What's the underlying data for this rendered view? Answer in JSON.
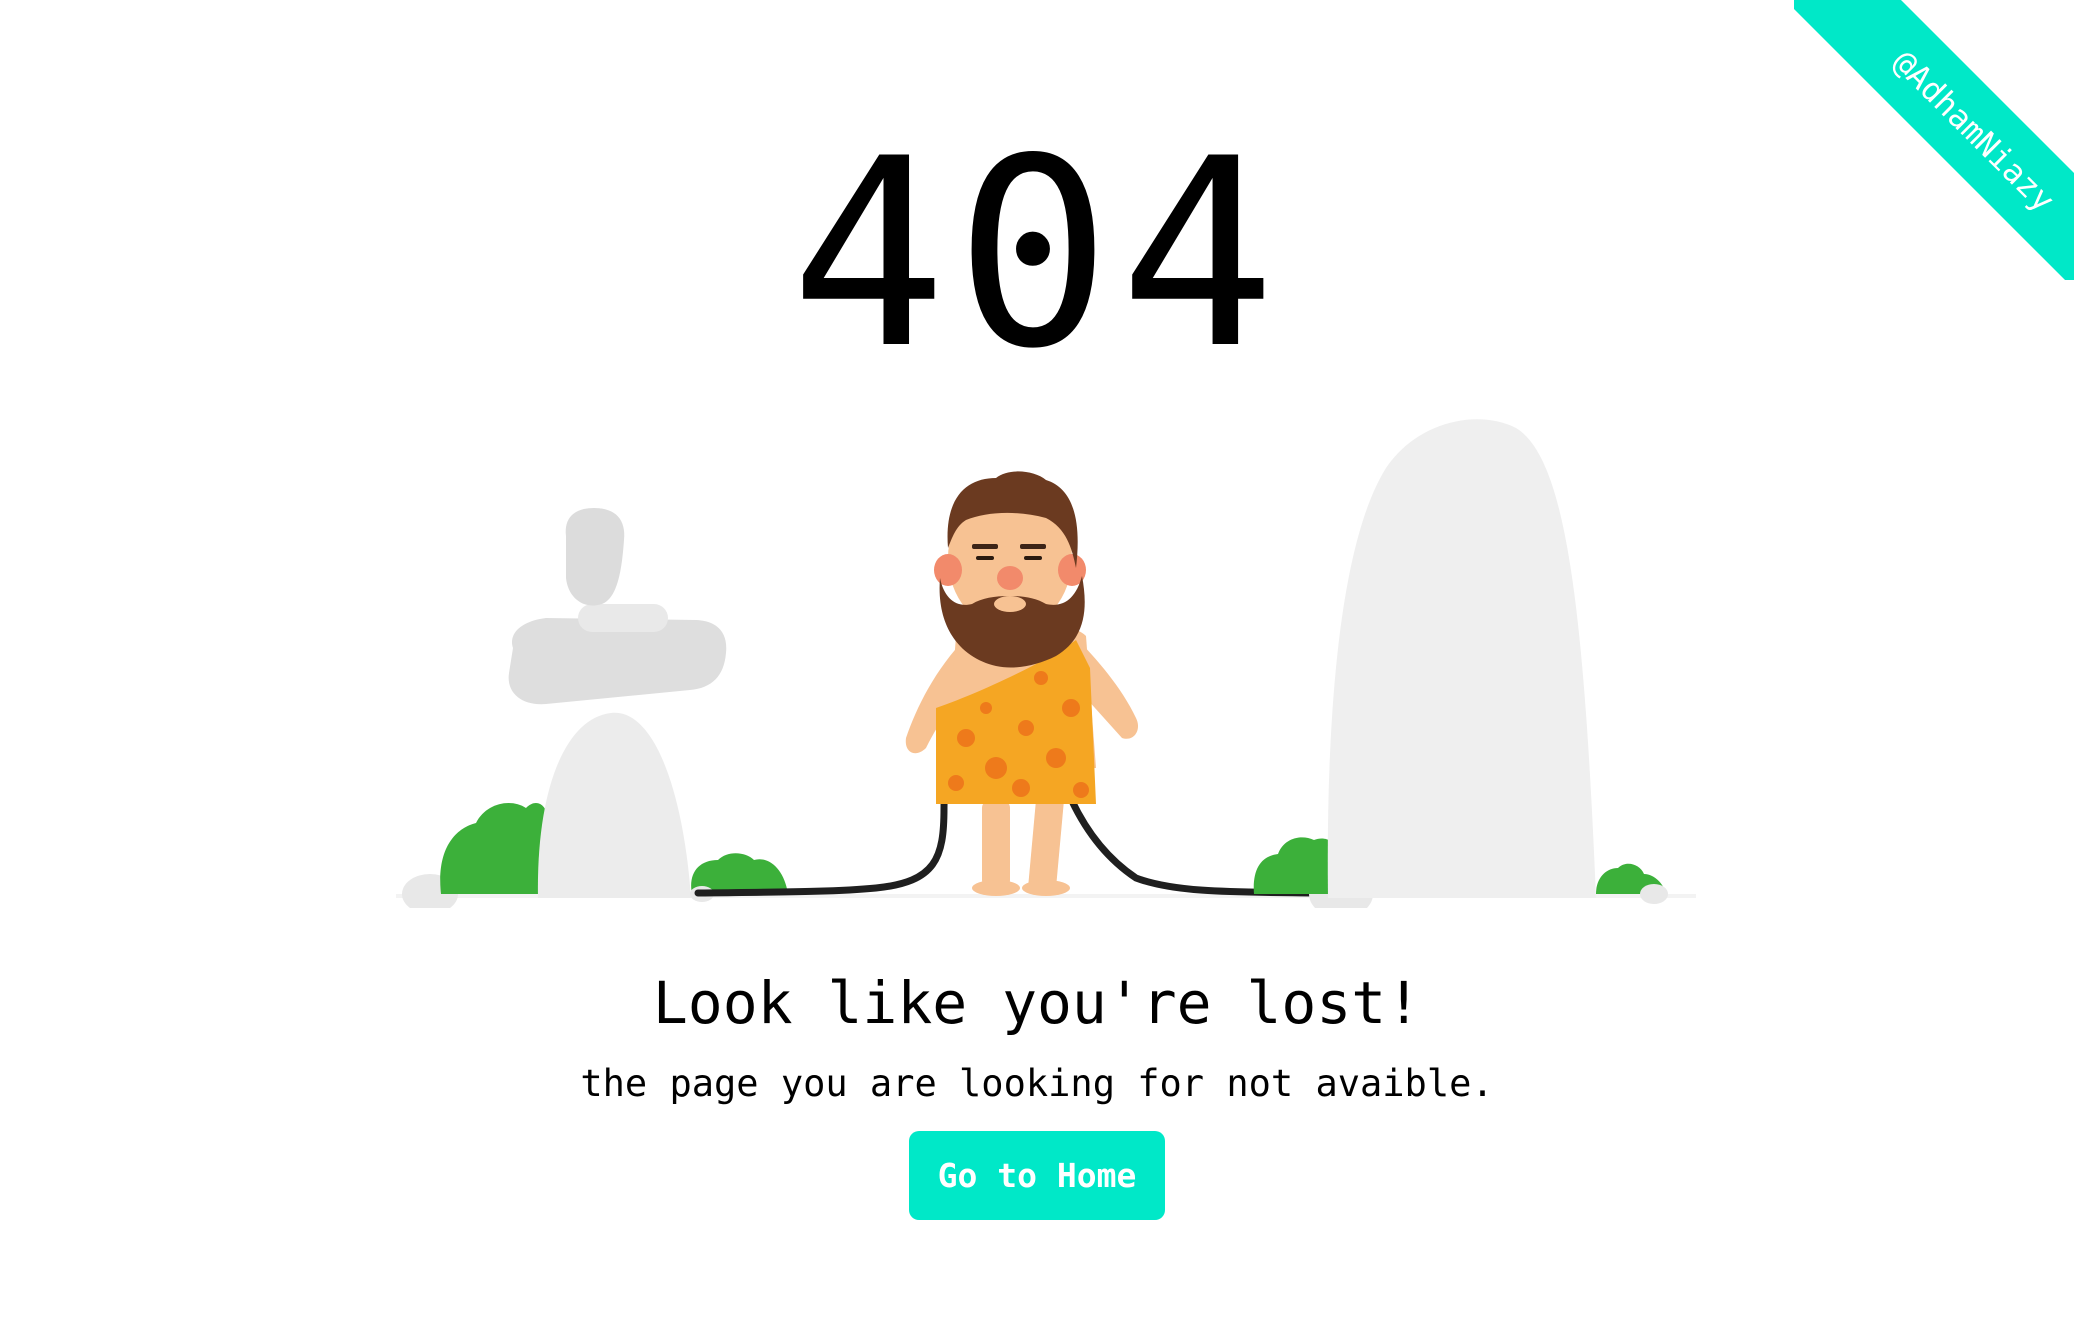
{
  "ribbon": {
    "label": "@AdhamNiazy"
  },
  "hero": {
    "code": "404",
    "illustration_icon": "caveman-holding-cable-illustration"
  },
  "message": {
    "headline": "Look like you're lost!",
    "subline": "the page you are looking for not avaible."
  },
  "actions": {
    "home_label": "Go to Home"
  },
  "colors": {
    "accent": "#00e8c8",
    "text": "#000000",
    "background": "#ffffff",
    "rock": "#e8e8e8",
    "bush": "#3cb03a",
    "skin": "#f7c293",
    "hair": "#6b3a20",
    "tunic": "#f5a623",
    "spots": "#ee7a1b",
    "cable": "#1f1f1f"
  }
}
